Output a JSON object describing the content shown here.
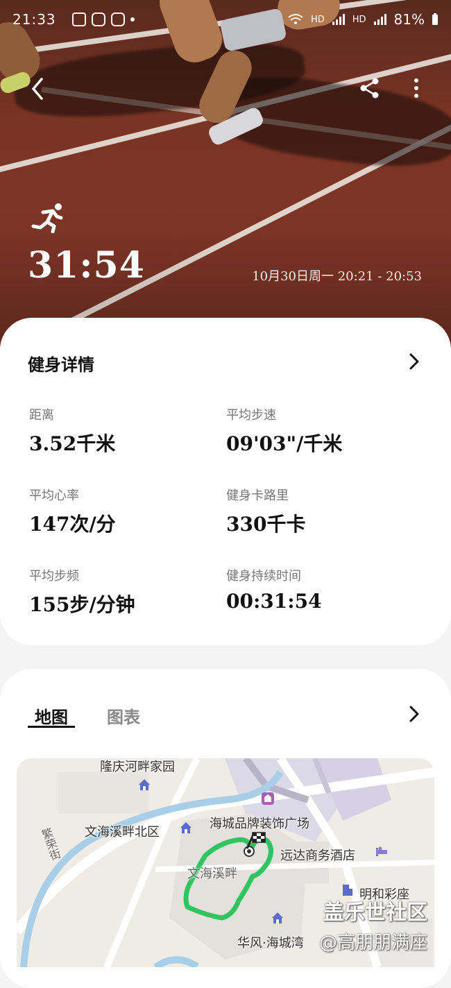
{
  "status_bar": {
    "time": "21:33",
    "network": "HD",
    "network2": "HD",
    "battery": "81%"
  },
  "header": {
    "duration": "31:54",
    "date_range": "10月30日周一 20:21 - 20:53"
  },
  "details": {
    "title": "健身详情",
    "metrics": [
      {
        "label": "距离",
        "value": "3.52千米"
      },
      {
        "label": "平均步速",
        "value": "09'03\"/千米"
      },
      {
        "label": "平均心率",
        "value": "147次/分"
      },
      {
        "label": "健身卡路里",
        "value": "330千卡"
      },
      {
        "label": "平均步频",
        "value": "155步/分钟"
      },
      {
        "label": "健身持续时间",
        "value": "00:31:54"
      }
    ]
  },
  "map_section": {
    "tabs": [
      "地图",
      "图表"
    ],
    "active_tab": "地图",
    "labels": {
      "longqing": "隆庆河畔家园",
      "wenhai_north": "文海溪畔北区",
      "haicheng": "海城品牌装饰广场",
      "yuanda": "远达商务酒店",
      "wenhai": "文海溪畔",
      "minghe": "明和彩座",
      "huafeng": "华风·海城湾",
      "street": "繁荣街"
    },
    "route_color": "#2fc45f"
  },
  "watermark": {
    "site": "盖乐世社区",
    "author": "@高朋朋满座"
  }
}
